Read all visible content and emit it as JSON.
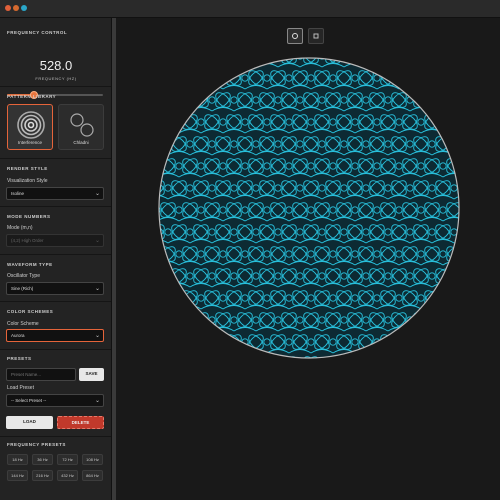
{
  "window": {
    "controls": [
      {
        "name": "close",
        "color": "#e0603a"
      },
      {
        "name": "minimize",
        "color": "#d66a2f"
      },
      {
        "name": "maximize",
        "color": "#2aa6c8"
      }
    ]
  },
  "frequency": {
    "section_title": "FREQUENCY CONTROL",
    "value": "528.0",
    "unit_label": "FREQUENCY (HZ)",
    "slider_fraction": 0.28
  },
  "pattern_library": {
    "section_title": "PATTERN LIBRARY",
    "cards": [
      {
        "label": "Interference",
        "icon": "concentric-rings-icon",
        "active": true
      },
      {
        "label": "Chladni",
        "icon": "circles-icon",
        "active": false
      }
    ]
  },
  "render_style": {
    "section_title": "RENDER STYLE",
    "label": "Visualization Style",
    "value": "Isoline"
  },
  "mode_numbers": {
    "section_title": "MODE NUMBERS",
    "label": "Mode (m,n)",
    "value": "(4,2) High Order"
  },
  "waveform_type": {
    "section_title": "WAVEFORM TYPE",
    "label": "Oscillator Type",
    "value": "Sine (Rich)"
  },
  "color_schemes": {
    "section_title": "COLOR SCHEMES",
    "label": "Color Scheme",
    "value": "Aurora"
  },
  "presets": {
    "section_title": "PRESETS",
    "name_placeholder": "Preset Name...",
    "save_label": "SAVE",
    "load_label_text": "Load Preset",
    "load_select_value": "-- Select Preset --",
    "load_button": "LOAD",
    "delete_button": "DELETE"
  },
  "frequency_presets": {
    "section_title": "FREQUENCY PRESETS",
    "buttons": [
      "18 Hz",
      "36 Hz",
      "72 Hz",
      "108 Hz",
      "144 Hz",
      "216 Hz",
      "432 Hz",
      "864 Hz"
    ]
  },
  "view_toggles": [
    {
      "icon": "circle-view-icon",
      "active": true
    },
    {
      "icon": "square-view-icon",
      "active": false
    }
  ],
  "colors": {
    "accent": "#e5643a",
    "pattern": "#29c4e0",
    "pattern_bg": "#0d2a33"
  }
}
